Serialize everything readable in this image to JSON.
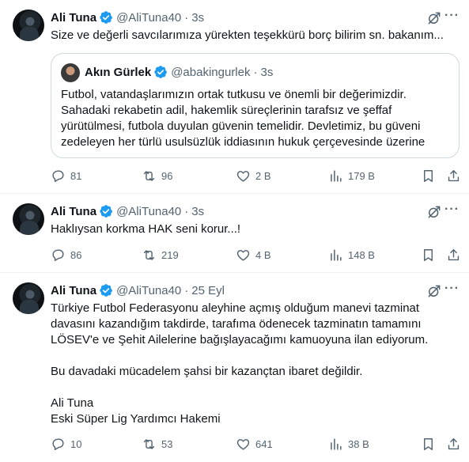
{
  "colors": {
    "text": "#0f1419",
    "muted": "#536471",
    "verified": "#1d9bf0",
    "border": "#eff3f4"
  },
  "tweets": [
    {
      "name": "Ali Tuna",
      "handle": "@AliTuna40",
      "dot": "·",
      "time": "3s",
      "lines": [
        "Size ve değerli savcılarımıza yürekten teşekkürü borç bilirim sn. bakanım..."
      ],
      "quote": {
        "name": "Akın Gürlek",
        "handle": "@abakingurlek",
        "dot": "·",
        "time": "3s",
        "lines": [
          "Futbol, vatandaşlarımızın ortak tutkusu ve önemli bir değerimizdir.",
          "Sahadaki rekabetin adil, hakemlik süreçlerinin tarafsız ve şeffaf",
          "yürütülmesi, futbola duyulan güvenin temelidir. Devletimiz, bu güveni",
          "zedeleyen her türlü usulsüzlük iddiasının hukuk çerçevesinde üzerine"
        ]
      },
      "stats": {
        "replies": "81",
        "reposts": "96",
        "likes": "2 B",
        "views": "179 B"
      }
    },
    {
      "name": "Ali Tuna",
      "handle": "@AliTuna40",
      "dot": "·",
      "time": "3s",
      "lines": [
        "Haklıysan korkma HAK seni korur...!"
      ],
      "stats": {
        "replies": "86",
        "reposts": "219",
        "likes": "4 B",
        "views": "148 B"
      }
    },
    {
      "name": "Ali Tuna",
      "handle": "@AliTuna40",
      "dot": "·",
      "time": "25 Eyl",
      "lines": [
        "Türkiye Futbol Federasyonu aleyhine açmış olduğum manevi tazminat",
        "davasını kazandığım takdirde, tarafıma ödenecek tazminatın tamamını",
        "LÖSEV'e ve Şehit Ailelerine bağışlayacağımı kamuoyuna ilan ediyorum.",
        "",
        "Bu davadaki mücadelem şahsi bir kazançtan ibaret değildir.",
        "",
        "Ali Tuna",
        "Eski Süper Lig Yardımcı Hakemi"
      ],
      "stats": {
        "replies": "10",
        "reposts": "53",
        "likes": "641",
        "views": "38 B"
      }
    }
  ],
  "icons": {
    "verified": "verified-badge-icon",
    "grok": "grok-icon",
    "more": "more-icon",
    "reply": "reply-icon",
    "repost": "repost-icon",
    "like": "heart-icon",
    "views": "views-icon",
    "bookmark": "bookmark-icon",
    "share": "share-icon"
  }
}
